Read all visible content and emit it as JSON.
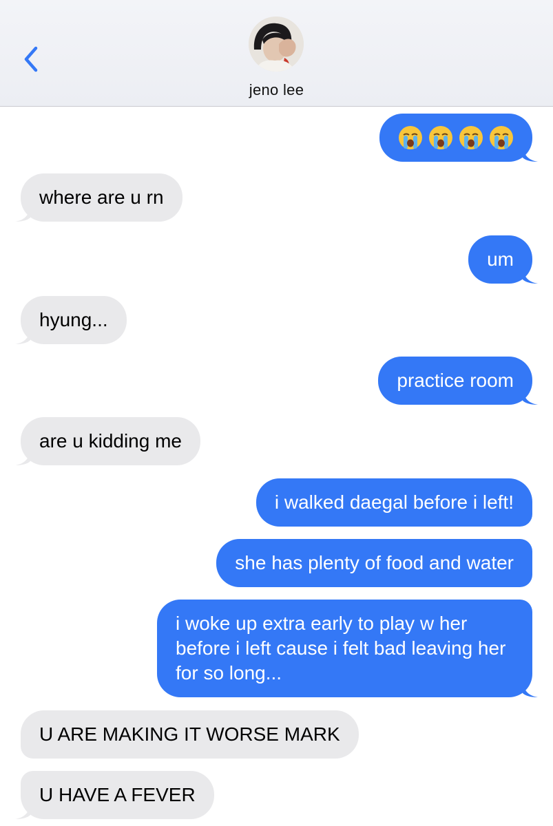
{
  "header": {
    "contact_name": "jeno lee",
    "back_icon": "chevron-left-icon",
    "avatar_icon": "contact-avatar"
  },
  "colors": {
    "sent_bubble": "#3478f6",
    "received_bubble": "#e9e9eb",
    "accent": "#3478f6"
  },
  "messages": [
    {
      "direction": "sent",
      "text": "😭😭😭😭",
      "emoji_icon": "loudly-crying-face-icon"
    },
    {
      "direction": "received",
      "text": "where are u rn"
    },
    {
      "direction": "sent",
      "text": "um"
    },
    {
      "direction": "received",
      "text": "hyung..."
    },
    {
      "direction": "sent",
      "text": "practice room"
    },
    {
      "direction": "received",
      "text": "are u kidding me"
    },
    {
      "direction": "sent",
      "text": "i walked daegal before i left!"
    },
    {
      "direction": "sent",
      "text": "she has plenty of food and water"
    },
    {
      "direction": "sent",
      "text": "i woke up extra early to play w her before i left cause i felt bad leaving her for so long..."
    },
    {
      "direction": "received",
      "text": "U ARE MAKING IT WORSE MARK"
    },
    {
      "direction": "received",
      "text": "U HAVE A FEVER"
    }
  ]
}
